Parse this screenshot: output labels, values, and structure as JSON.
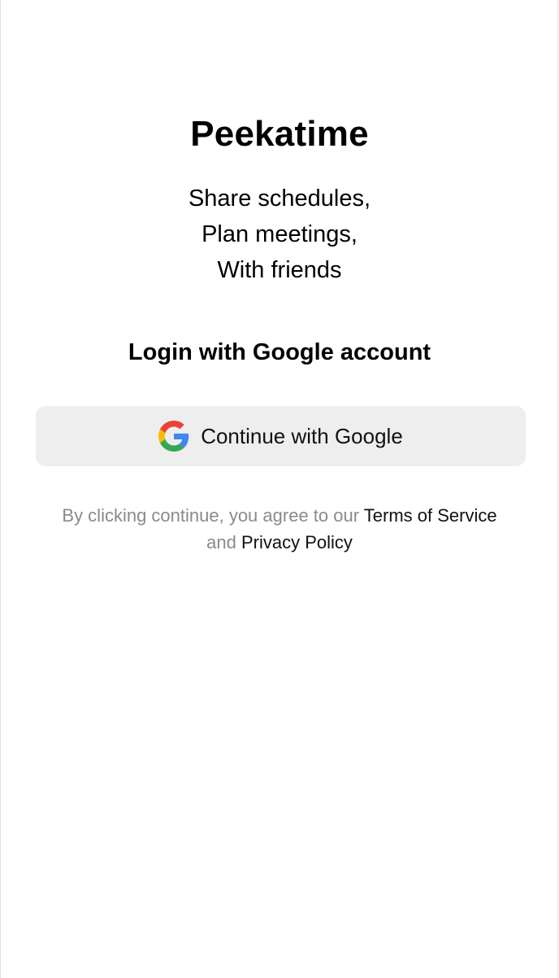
{
  "app": {
    "title": "Peekatime",
    "tagline": [
      "Share schedules,",
      "Plan meetings,",
      "With friends"
    ]
  },
  "login": {
    "heading": "Login with Google account",
    "google_button_label": "Continue with Google",
    "google_icon": "google-g-logo"
  },
  "legal": {
    "prefix": "By clicking continue, you agree to our",
    "terms_link": "Terms of Service",
    "conjunction": "and",
    "privacy_link": "Privacy Policy"
  },
  "colors": {
    "button_background": "#eeeeee",
    "muted_text": "#8a8a8a",
    "google_blue": "#4285F4",
    "google_red": "#EA4335",
    "google_yellow": "#FBBC05",
    "google_green": "#34A853"
  }
}
